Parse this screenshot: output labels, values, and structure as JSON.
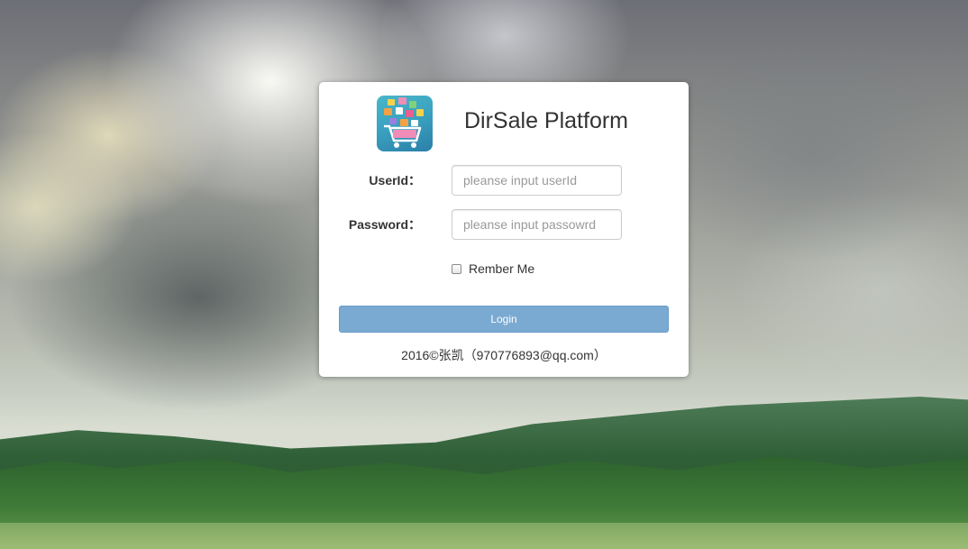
{
  "brand": {
    "title": "DirSale Platform",
    "logo_icon": "shopping-cart-apps-icon"
  },
  "form": {
    "userid_label": "UserId：",
    "userid_placeholder": "pleanse input userId",
    "userid_value": "",
    "password_label": "Password：",
    "password_placeholder": "pleanse input passowrd",
    "password_value": "",
    "remember_label": "Rember Me",
    "remember_checked": false,
    "login_label": "Login"
  },
  "footer": {
    "text": "2016©张凯（970776893@qq.com）"
  },
  "colors": {
    "login_button": "#7aa9d1",
    "card": "#ffffff",
    "text": "#333333"
  }
}
